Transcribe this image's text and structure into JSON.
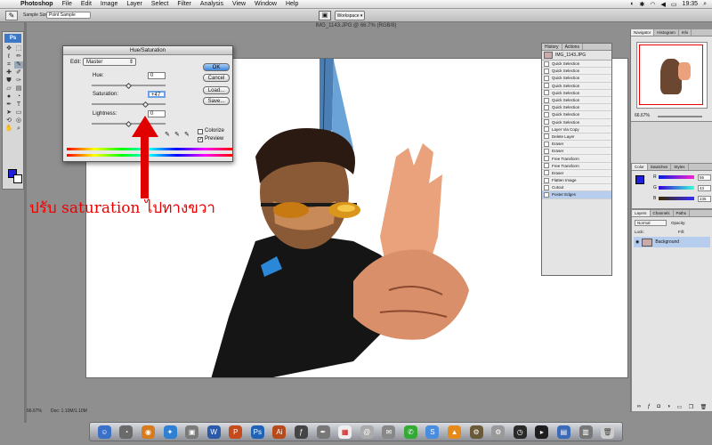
{
  "menubar": {
    "app_name": "Photoshop",
    "items": [
      "File",
      "Edit",
      "Image",
      "Layer",
      "Select",
      "Filter",
      "Analysis",
      "View",
      "Window",
      "Help"
    ],
    "clock": "19:35"
  },
  "options_bar": {
    "sample_size_label": "Sample Size:",
    "sample_size_value": "Point Sample",
    "workspace_label": "Workspace ▾"
  },
  "document": {
    "title": "IMG_1143.JPG @ 66.7% (RGB/8)",
    "zoom": "66.67%",
    "doc_size": "Doc: 1.10M/1.10M"
  },
  "toolbox": {
    "logo": "Ps"
  },
  "dialog": {
    "title": "Hue/Saturation",
    "edit_label": "Edit:",
    "edit_value": "Master",
    "hue_label": "Hue:",
    "hue_value": "0",
    "saturation_label": "Saturation:",
    "saturation_value": "+47",
    "lightness_label": "Lightness:",
    "lightness_value": "0",
    "buttons": {
      "ok": "OK",
      "cancel": "Cancel",
      "load": "Load...",
      "save": "Save..."
    },
    "colorize_label": "Colorize",
    "preview_label": "Preview",
    "preview_checked": "✓",
    "hue_level": 0.5,
    "saturation_level": 0.735,
    "lightness_level": 0.5
  },
  "annotation": {
    "text": "ปรับ saturation ไปทางขวา",
    "color": "#e00000"
  },
  "history_panel": {
    "tabs": [
      "History",
      "Actions"
    ],
    "snapshot": "IMG_1143.JPG",
    "items": [
      "Quick Selection",
      "Quick Selection",
      "Quick Selection",
      "Quick Selection",
      "Quick Selection",
      "Quick Selection",
      "Quick Selection",
      "Quick Selection",
      "Quick Selection",
      "Layer Via Copy",
      "Delete Layer",
      "Eraser",
      "Eraser",
      "Free Transform",
      "Free Transform",
      "Eraser",
      "Flatten Image",
      "Cutout",
      "Poster Edges"
    ],
    "current_index": 18
  },
  "navigator_panel": {
    "tabs": [
      "Navigator",
      "Histogram",
      "Info"
    ],
    "zoom": "66.67%"
  },
  "color_panel": {
    "tabs": [
      "Color",
      "Swatches",
      "Styles"
    ],
    "channels": [
      {
        "label": "R",
        "value": "56"
      },
      {
        "label": "G",
        "value": "43"
      },
      {
        "label": "B",
        "value": "235"
      }
    ]
  },
  "layers_panel": {
    "tabs": [
      "Layers",
      "Channels",
      "Paths"
    ],
    "blend_mode": "Normal",
    "opacity_label": "Opacity:",
    "lock_label": "Lock:",
    "fill_label": "Fill:",
    "layer_name": "Background"
  },
  "colors": {
    "foreground": "#1f1fd8",
    "accent": "#3f86dd",
    "annotation": "#e00000"
  }
}
